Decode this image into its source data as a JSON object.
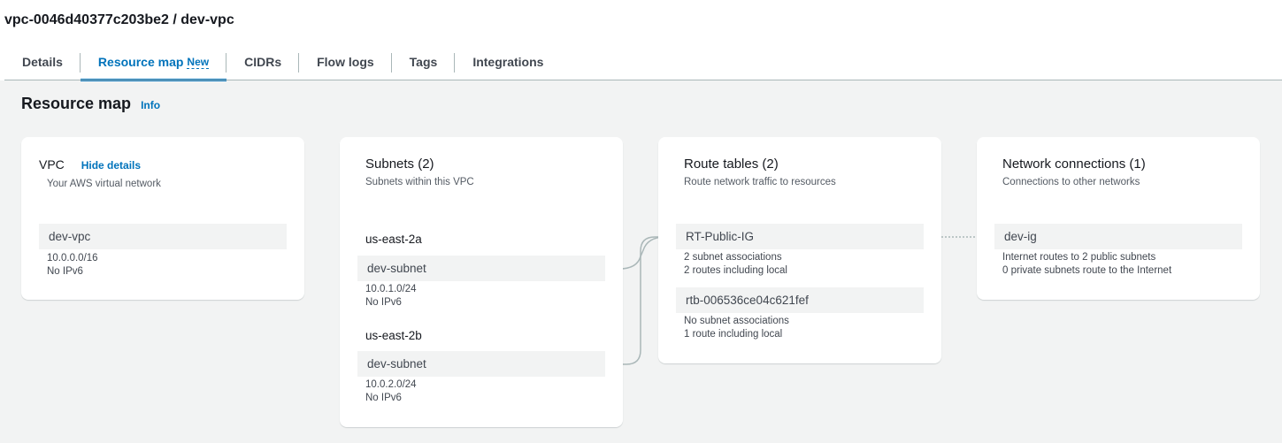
{
  "page": {
    "title": "vpc-0046d40377c203be2 / dev-vpc"
  },
  "tabs": [
    {
      "label": "Details"
    },
    {
      "label": "Resource map",
      "badge": "New"
    },
    {
      "label": "CIDRs"
    },
    {
      "label": "Flow logs"
    },
    {
      "label": "Tags"
    },
    {
      "label": "Integrations"
    }
  ],
  "active_tab": "Resource map",
  "section": {
    "title": "Resource map",
    "info_label": "Info"
  },
  "vpc_card": {
    "title": "VPC",
    "hide_details_label": "Hide details",
    "subtitle": "Your AWS virtual network",
    "item": {
      "name": "dev-vpc",
      "cidr": "10.0.0.0/16",
      "ipv6": "No IPv6"
    }
  },
  "subnets_card": {
    "title": "Subnets (2)",
    "subtitle": "Subnets within this VPC",
    "groups": [
      {
        "az": "us-east-2a",
        "name": "dev-subnet",
        "cidr": "10.0.1.0/24",
        "ipv6": "No IPv6"
      },
      {
        "az": "us-east-2b",
        "name": "dev-subnet",
        "cidr": "10.0.2.0/24",
        "ipv6": "No IPv6"
      }
    ]
  },
  "route_tables_card": {
    "title": "Route tables (2)",
    "subtitle": "Route network traffic to resources",
    "items": [
      {
        "name": "RT-Public-IG",
        "line1": "2 subnet associations",
        "line2": "2 routes including local"
      },
      {
        "name": "rtb-006536ce04c621fef",
        "line1": "No subnet associations",
        "line2": "1 route including local"
      }
    ]
  },
  "network_card": {
    "title": "Network connections (1)",
    "subtitle": "Connections to other networks",
    "item": {
      "name": "dev-ig",
      "line1": "Internet routes to 2 public subnets",
      "line2": "0 private subnets route to the Internet"
    }
  },
  "colors": {
    "accent": "#0073bb",
    "background": "#f2f3f3",
    "card": "#ffffff",
    "connector": "#aab7b8"
  }
}
